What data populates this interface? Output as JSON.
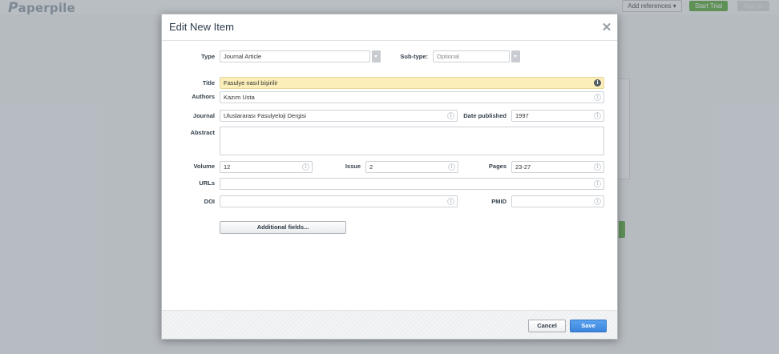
{
  "app": {
    "logo_text": "aperpile",
    "logo_initial": "P",
    "add_references_label": "Add references",
    "start_trial_label": "Start Trial",
    "sign_in_label": "Sign in"
  },
  "modal": {
    "title": "Edit New Item",
    "type_label": "Type",
    "type_value": "Journal Article",
    "subtype_label": "Sub-type:",
    "subtype_value": "Optional",
    "title_label": "Title",
    "title_value": "Fasulye nasıl bişirilir",
    "authors_label": "Authors",
    "authors_value": "Kazım Usta",
    "journal_label": "Journal",
    "journal_value": "Uluslararası Fasulyeloji Dergisi",
    "date_label": "Date published",
    "date_value": "1997",
    "abstract_label": "Abstract",
    "abstract_value": "",
    "volume_label": "Volume",
    "volume_value": "12",
    "issue_label": "Issue",
    "issue_value": "2",
    "pages_label": "Pages",
    "pages_value": "23-27",
    "urls_label": "URLs",
    "urls_value": "",
    "doi_label": "DOI",
    "doi_value": "",
    "pmid_label": "PMID",
    "pmid_value": "",
    "additional_fields_label": "Additional fields...",
    "cancel_label": "Cancel",
    "save_label": "Save"
  },
  "icons": {
    "info": "info-icon",
    "close": "close-icon",
    "dropdown": "caret-down-icon"
  },
  "colors": {
    "title_highlight": "#fbeeb8",
    "save_button": "#3b84dc",
    "start_trial": "#59a83c"
  }
}
